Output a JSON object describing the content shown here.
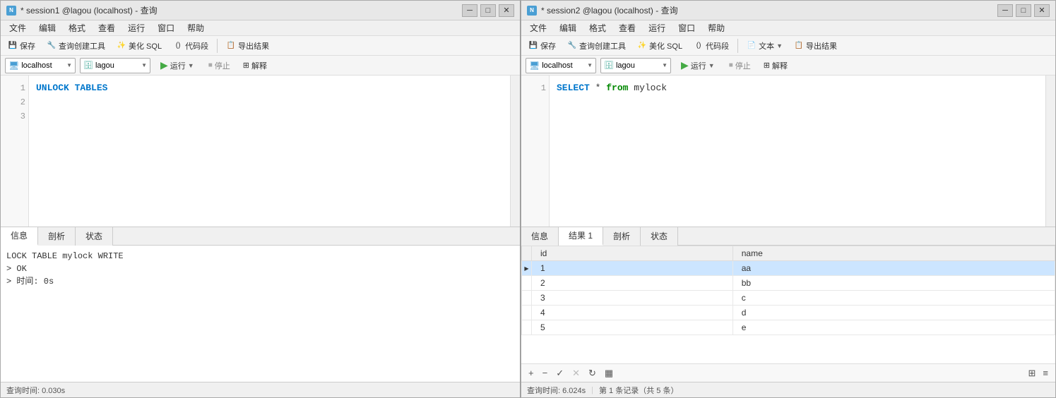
{
  "session1": {
    "title": "* session1 @lagou (localhost) - 查询",
    "menu": [
      "文件",
      "编辑",
      "格式",
      "查看",
      "运行",
      "窗口",
      "帮助"
    ],
    "toolbar": {
      "save": "保存",
      "query_builder": "查询创建工具",
      "beautify": "美化 SQL",
      "code_snippet": "代码段",
      "export": "导出结果"
    },
    "conn_host": "localhost",
    "conn_db": "lagou",
    "run_label": "运行",
    "stop_label": "停止",
    "explain_label": "解释",
    "sql": "UNLOCK TABLES",
    "line_numbers": [
      "1",
      "2",
      "3"
    ],
    "tabs": [
      "信息",
      "剖析",
      "状态"
    ],
    "active_tab": "信息",
    "info_lines": [
      "LOCK TABLE mylock WRITE",
      "> OK",
      "> 时间: 0s"
    ],
    "status_text": "查询时间: 0.030s"
  },
  "session2": {
    "title": "* session2 @lagou (localhost) - 查询",
    "menu": [
      "文件",
      "编辑",
      "格式",
      "查看",
      "运行",
      "窗口",
      "帮助"
    ],
    "toolbar": {
      "save": "保存",
      "query_builder": "查询创建工具",
      "beautify": "美化 SQL",
      "code_snippet": "代码段",
      "text": "文本",
      "export": "导出结果"
    },
    "conn_host": "localhost",
    "conn_db": "lagou",
    "run_label": "运行",
    "stop_label": "停止",
    "explain_label": "解释",
    "sql_keyword1": "SELECT",
    "sql_star": "*",
    "sql_from": "from",
    "sql_table": "mylock",
    "line_numbers": [
      "1"
    ],
    "tabs": [
      "信息",
      "结果 1",
      "剖析",
      "状态"
    ],
    "active_tab": "结果 1",
    "result_columns": [
      "id",
      "name"
    ],
    "result_rows": [
      {
        "id": "1",
        "name": "aa",
        "selected": true
      },
      {
        "id": "2",
        "name": "bb",
        "selected": false
      },
      {
        "id": "3",
        "name": "c",
        "selected": false
      },
      {
        "id": "4",
        "name": "d",
        "selected": false
      },
      {
        "id": "5",
        "name": "e",
        "selected": false
      }
    ],
    "table_toolbar": {
      "add": "+",
      "remove": "−",
      "confirm": "✓",
      "cancel": "✕",
      "refresh": "↻",
      "more": "▦"
    },
    "status_text": "查询时间: 6.024s",
    "row_count_text": "第 1 条记录（共 5 条）"
  }
}
